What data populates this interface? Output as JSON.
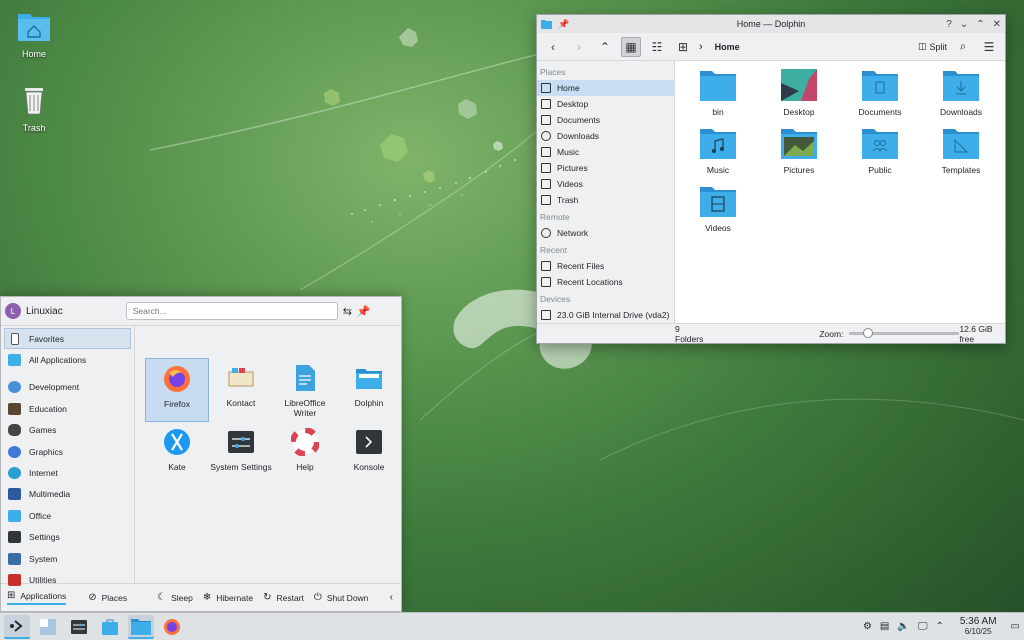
{
  "desktop": {
    "icons": [
      {
        "label": "Home",
        "icon": "home-folder-icon"
      },
      {
        "label": "Trash",
        "icon": "trash-icon"
      }
    ]
  },
  "dolphin": {
    "title": "Home — Dolphin",
    "title_controls": [
      "?",
      "⌄",
      "⌃",
      "✕"
    ],
    "breadcrumb": "Home",
    "split_label": "Split",
    "places": [
      {
        "heading": "Places",
        "items": [
          "Home",
          "Desktop",
          "Documents",
          "Downloads",
          "Music",
          "Pictures",
          "Videos",
          "Trash"
        ]
      },
      {
        "heading": "Remote",
        "items": [
          "Network"
        ]
      },
      {
        "heading": "Recent",
        "items": [
          "Recent Files",
          "Recent Locations"
        ]
      },
      {
        "heading": "Devices",
        "items": [
          "23.0 GiB Internal Drive (vda2)"
        ]
      }
    ],
    "folders": [
      "bin",
      "Desktop",
      "Documents",
      "Downloads",
      "Music",
      "Pictures",
      "Public",
      "Templates",
      "Videos"
    ],
    "status": {
      "count": "9 Folders",
      "zoom_label": "Zoom:",
      "free": "12.6 GiB free"
    },
    "accent": "#3daee9"
  },
  "launcher": {
    "user": "Linuxiac",
    "avatar_letter": "L",
    "search_placeholder": "Search...",
    "categories": [
      "Favorites",
      "All Applications",
      "Development",
      "Education",
      "Games",
      "Graphics",
      "Internet",
      "Multimedia",
      "Office",
      "Settings",
      "System",
      "Utilities"
    ],
    "apps": [
      {
        "name": "Firefox",
        "icon": "firefox-icon"
      },
      {
        "name": "Kontact",
        "icon": "kontact-icon"
      },
      {
        "name": "LibreOffice Writer",
        "icon": "writer-icon"
      },
      {
        "name": "Dolphin",
        "icon": "dolphin-icon"
      },
      {
        "name": "Kate",
        "icon": "kate-icon"
      },
      {
        "name": "System Settings",
        "icon": "settings-icon"
      },
      {
        "name": "Help",
        "icon": "help-icon"
      },
      {
        "name": "Konsole",
        "icon": "konsole-icon"
      }
    ],
    "footer": {
      "applications": "Applications",
      "places": "Places",
      "sleep": "Sleep",
      "hibernate": "Hibernate",
      "restart": "Restart",
      "shutdown": "Shut Down"
    }
  },
  "taskbar": {
    "time": "5:36 AM",
    "date": "6/10/25"
  }
}
